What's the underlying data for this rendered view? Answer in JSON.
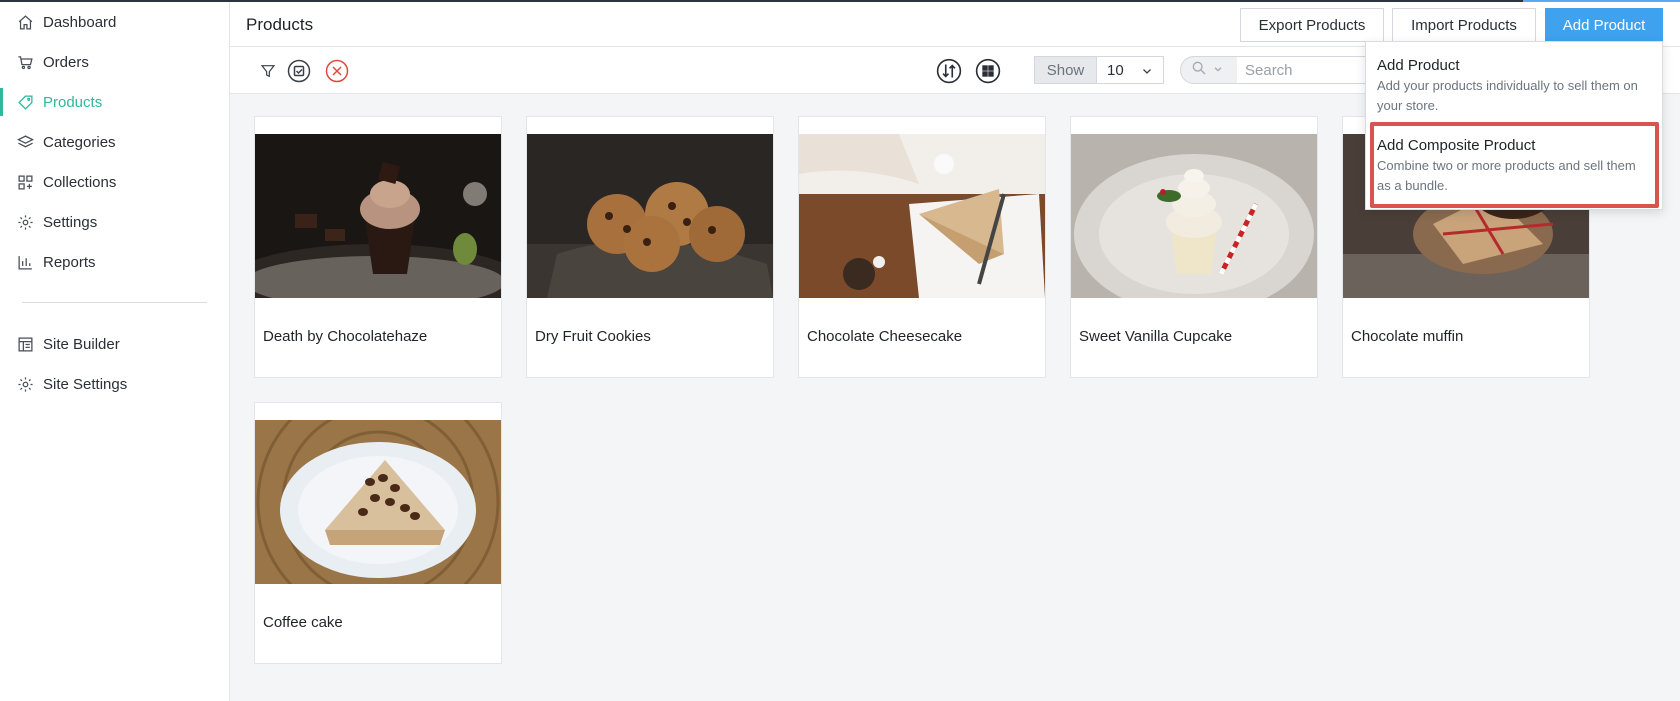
{
  "sidebar": {
    "items": [
      {
        "label": "Dashboard",
        "icon": "home-icon"
      },
      {
        "label": "Orders",
        "icon": "cart-icon"
      },
      {
        "label": "Products",
        "icon": "tag-icon",
        "active": true
      },
      {
        "label": "Categories",
        "icon": "layers-icon"
      },
      {
        "label": "Collections",
        "icon": "grid-plus-icon"
      },
      {
        "label": "Settings",
        "icon": "gear-icon"
      },
      {
        "label": "Reports",
        "icon": "bar-chart-icon"
      }
    ],
    "items2": [
      {
        "label": "Site Builder",
        "icon": "layout-icon"
      },
      {
        "label": "Site Settings",
        "icon": "gear-icon"
      }
    ]
  },
  "header": {
    "title": "Products",
    "export_label": "Export Products",
    "import_label": "Import Products",
    "add_label": "Add Product"
  },
  "toolbar": {
    "show_label": "Show",
    "show_value": "10",
    "search_placeholder": "Search"
  },
  "dropdown": {
    "items": [
      {
        "title": "Add Product",
        "desc": "Add your products individually to sell them on your store."
      },
      {
        "title": "Add Composite Product",
        "desc": "Combine two or more products and sell them as a bundle."
      }
    ]
  },
  "products": [
    {
      "name": "Death by Chocolatehaze"
    },
    {
      "name": "Dry Fruit Cookies"
    },
    {
      "name": "Chocolate Cheesecake"
    },
    {
      "name": "Sweet Vanilla Cupcake"
    },
    {
      "name": "Chocolate muffin"
    },
    {
      "name": "Coffee cake"
    }
  ],
  "colors": {
    "accent": "#2fb89a",
    "primary_button": "#3ea2ef",
    "highlight_border": "#d9534f"
  }
}
